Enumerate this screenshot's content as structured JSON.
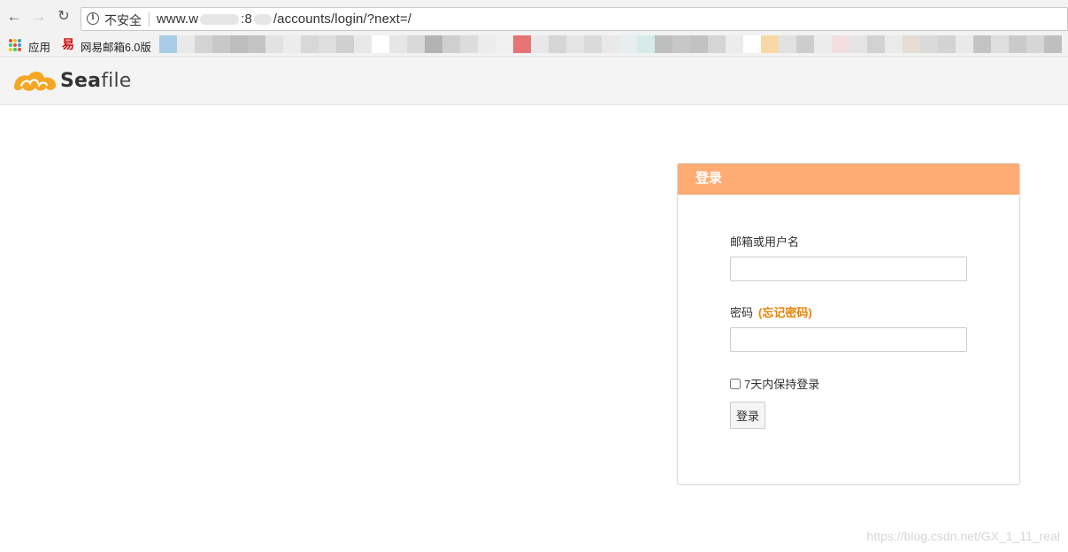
{
  "browser": {
    "security_label": "不安全",
    "url_prefix": "www.w",
    "url_mid": ":8",
    "url_suffix": "/accounts/login/?next=/",
    "info_glyph": "i",
    "bookmarks": {
      "apps_label": "应用",
      "netease_label": "网易邮箱6.0版",
      "netease_icon_glyph": "易"
    }
  },
  "header": {
    "logo_text_bold": "Sea",
    "logo_text_regular": "file"
  },
  "login": {
    "title": "登录",
    "username_label": "邮箱或用户名",
    "username_value": "",
    "password_label": "密码",
    "forgot_link": "(忘记密码)",
    "password_value": "",
    "remember_label": "7天内保持登录",
    "remember_checked": false,
    "submit_label": "登录"
  },
  "watermark": "https://blog.csdn.net/GX_1_11_real",
  "colors": {
    "panel_header": "#feac74",
    "forgot_link": "#eb8205",
    "logo_orange": "#f5a623"
  }
}
